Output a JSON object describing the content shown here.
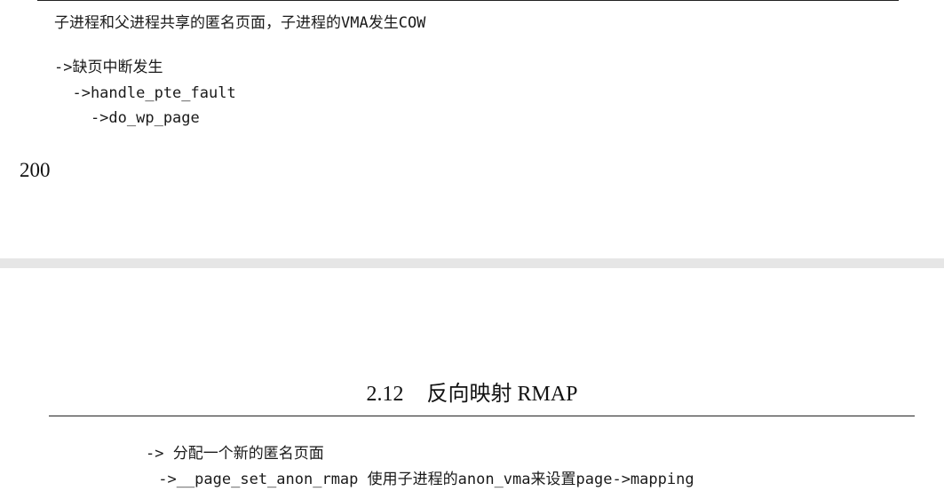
{
  "top_page": {
    "lines": [
      "子进程和父进程共享的匿名页面，子进程的VMA发生COW",
      "->缺页中断发生",
      "  ->handle_pte_fault",
      "    ->do_wp_page"
    ],
    "page_number": "200"
  },
  "bottom_page": {
    "running_head": {
      "section_number": "2.12",
      "section_title": "反向映射 RMAP"
    },
    "lines": [
      "-> 分配一个新的匿名页面",
      " ->__page_set_anon_rmap 使用子进程的anon_vma来设置page->mapping"
    ]
  }
}
